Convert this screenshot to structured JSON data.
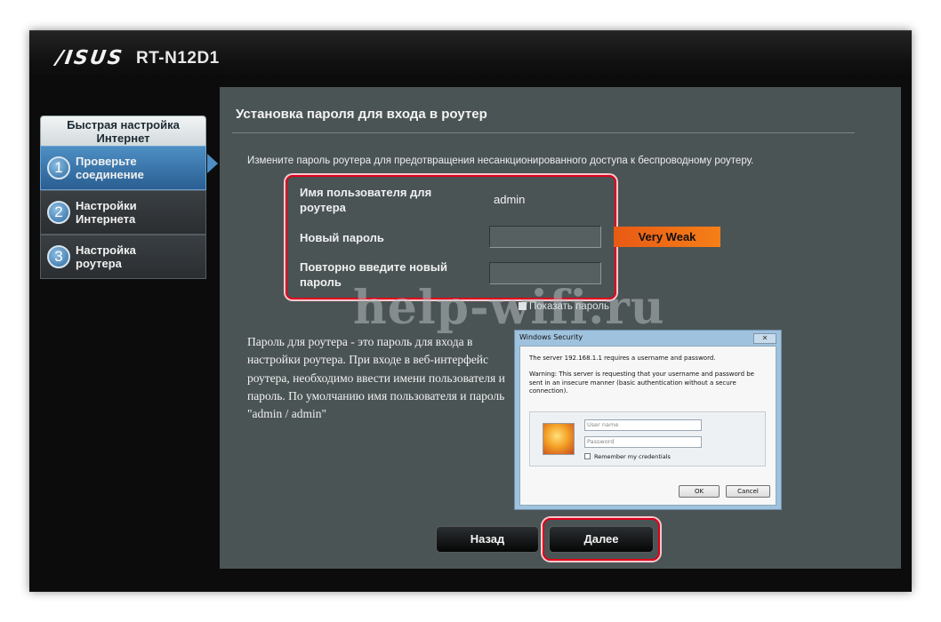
{
  "header": {
    "brand": "/ISUS",
    "model": "RT-N12D1"
  },
  "sidebar": {
    "title": "Быстрая настройка Интернет",
    "items": [
      {
        "num": "1",
        "label": "Проверьте соединение",
        "active": true
      },
      {
        "num": "2",
        "label": "Настройки Интернета",
        "active": false
      },
      {
        "num": "3",
        "label": "Настройка роутера",
        "active": false
      }
    ]
  },
  "main": {
    "title": "Установка пароля для входа в роутер",
    "description": "Измените пароль роутера для предотвращения несанкционированного доступа к беспроводному роутеру.",
    "form": {
      "username_label": "Имя пользователя для роутера",
      "username_value": "admin",
      "new_password_label": "Новый пароль",
      "new_password_value": "",
      "confirm_password_label": "Повторно введите новый пароль",
      "confirm_password_value": "",
      "strength": "Very Weak",
      "show_password": "Показать пароль"
    },
    "help_text": "Пароль для роутера - это пароль для входа в настройки роутера. При входе в веб-интерфейс роутера, необходимо ввести имени пользователя и пароль. По умолчанию имя пользователя и пароль \"admin / admin\"",
    "watermark": "help-wifi.ru"
  },
  "dialog": {
    "title": "Windows Security",
    "line1": "The server 192.168.1.1 requires a username and password.",
    "warning": "Warning: This server is requesting that your username and password be sent in an insecure manner (basic authentication without a secure connection).",
    "username_placeholder": "User name",
    "password_placeholder": "Password",
    "remember": "Remember my credentials",
    "ok": "OK",
    "cancel": "Cancel"
  },
  "buttons": {
    "back": "Назад",
    "next": "Далее"
  },
  "colors": {
    "accent_blue": "#4d8fc4",
    "highlight_red": "#e0001a",
    "strength_orange": "#f57f18",
    "panel": "#4b5455"
  }
}
